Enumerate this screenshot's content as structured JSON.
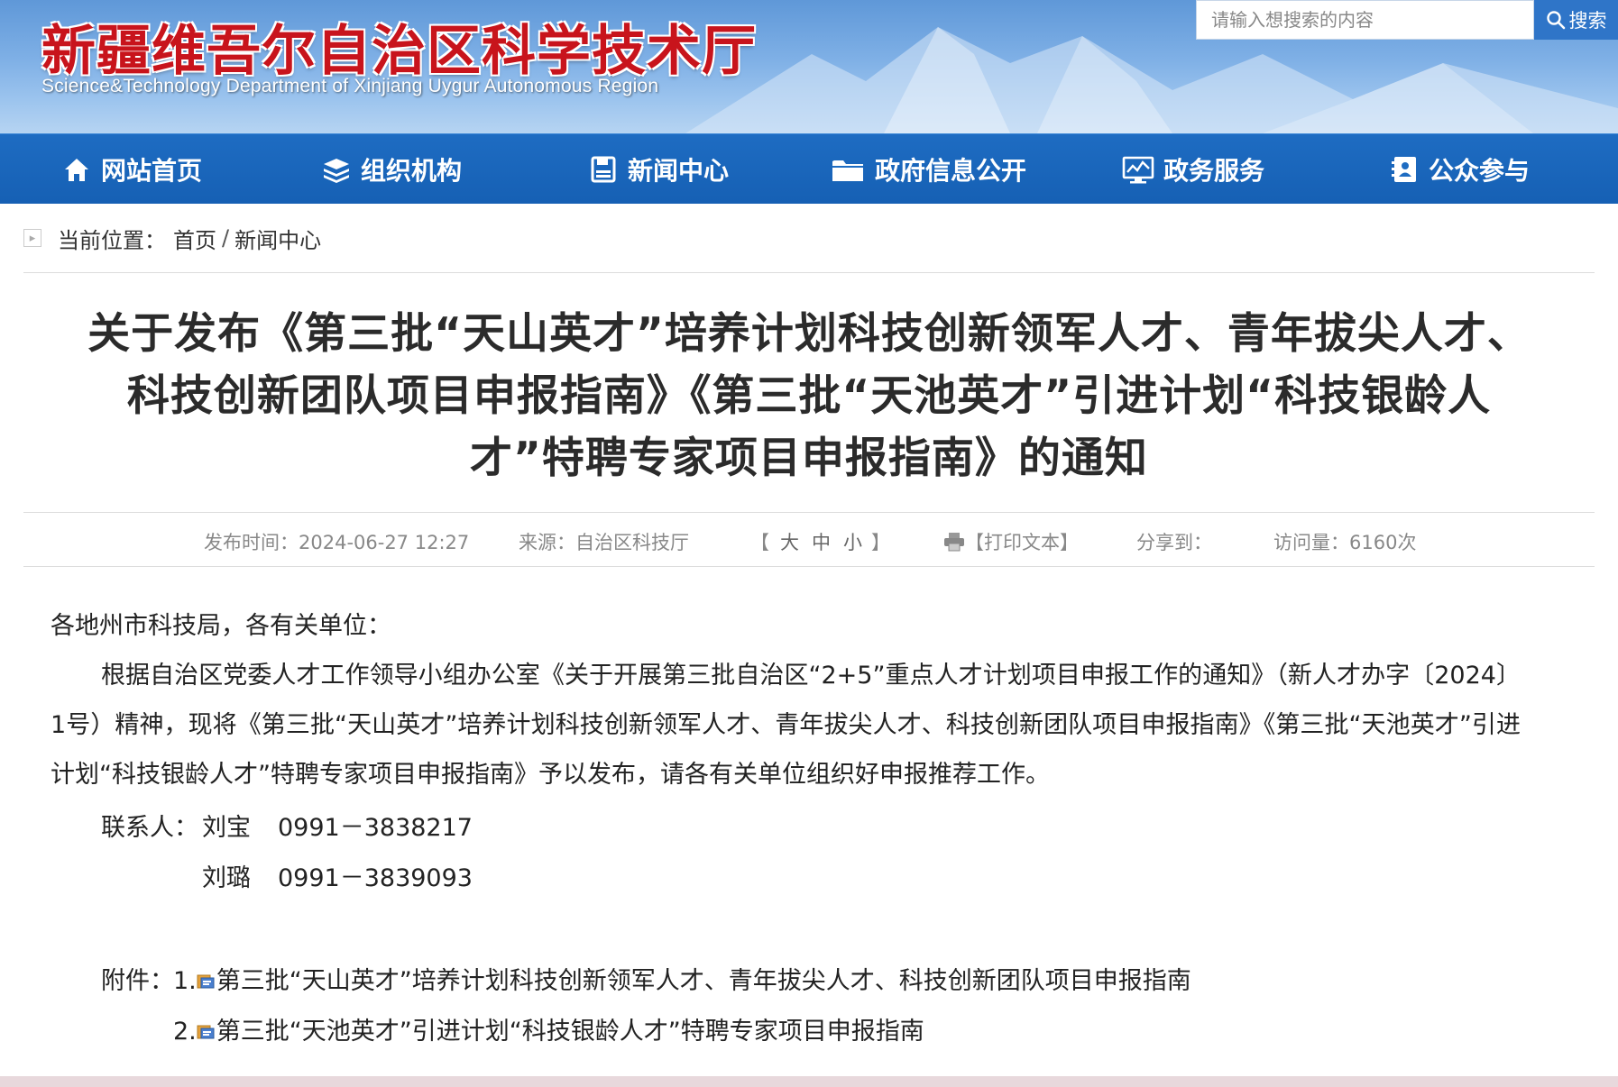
{
  "header": {
    "title": "新疆维吾尔自治区科学技术厅",
    "subtitle": "Science&Technology Department of Xinjiang Uygur Autonomous Region",
    "search": {
      "placeholder": "请输入想搜索的内容",
      "button_label": "搜索"
    }
  },
  "nav": {
    "items": [
      {
        "label": "网站首页",
        "icon": "home-icon"
      },
      {
        "label": "组织机构",
        "icon": "layers-icon"
      },
      {
        "label": "新闻中心",
        "icon": "save-icon"
      },
      {
        "label": "政府信息公开",
        "icon": "folder-icon"
      },
      {
        "label": "政务服务",
        "icon": "chart-monitor-icon"
      },
      {
        "label": "公众参与",
        "icon": "contact-card-icon"
      }
    ]
  },
  "breadcrumb": {
    "prefix": "当前位置：",
    "home": "首页",
    "separator": "/",
    "current": "新闻中心"
  },
  "article": {
    "title": "关于发布《第三批“天山英才”培养计划科技创新领军人才、青年拔尖人才、科技创新团队项目申报指南》《第三批“天池英才”引进计划“科技银龄人才”特聘专家项目申报指南》的通知",
    "meta": {
      "publish_time": "发布时间：2024-06-27 12:27",
      "source": "来源：自治区科技厅",
      "font_size_open": "【",
      "font_large": "大",
      "font_medium": "中",
      "font_small": "小",
      "font_size_close": "】",
      "print": "【打印文本】",
      "share": "分享到：",
      "views": "访问量：6160次"
    },
    "salutation": "各地州市科技局，各有关单位：",
    "paragraph": "根据自治区党委人才工作领导小组办公室《关于开展第三批自治区“2+5”重点人才计划项目申报工作的通知》（新人才办字〔2024〕1号）精神，现将《第三批“天山英才”培养计划科技创新领军人才、青年拔尖人才、科技创新团队项目申报指南》《第三批“天池英才”引进计划“科技银龄人才”特聘专家项目申报指南》予以发布，请各有关单位组织好申报推荐工作。",
    "contacts_label": "联系人：",
    "contacts": [
      {
        "name": "刘宝",
        "phone": "0991－3838217"
      },
      {
        "name": "刘璐",
        "phone": "0991－3839093"
      }
    ],
    "attachments_label": "附件：",
    "attachments": [
      {
        "index": "1.",
        "title": "第三批“天山英才”培养计划科技创新领军人才、青年拔尖人才、科技创新团队项目申报指南"
      },
      {
        "index": "2.",
        "title": "第三批“天池英才”引进计划“科技银龄人才”特聘专家项目申报指南"
      }
    ]
  }
}
